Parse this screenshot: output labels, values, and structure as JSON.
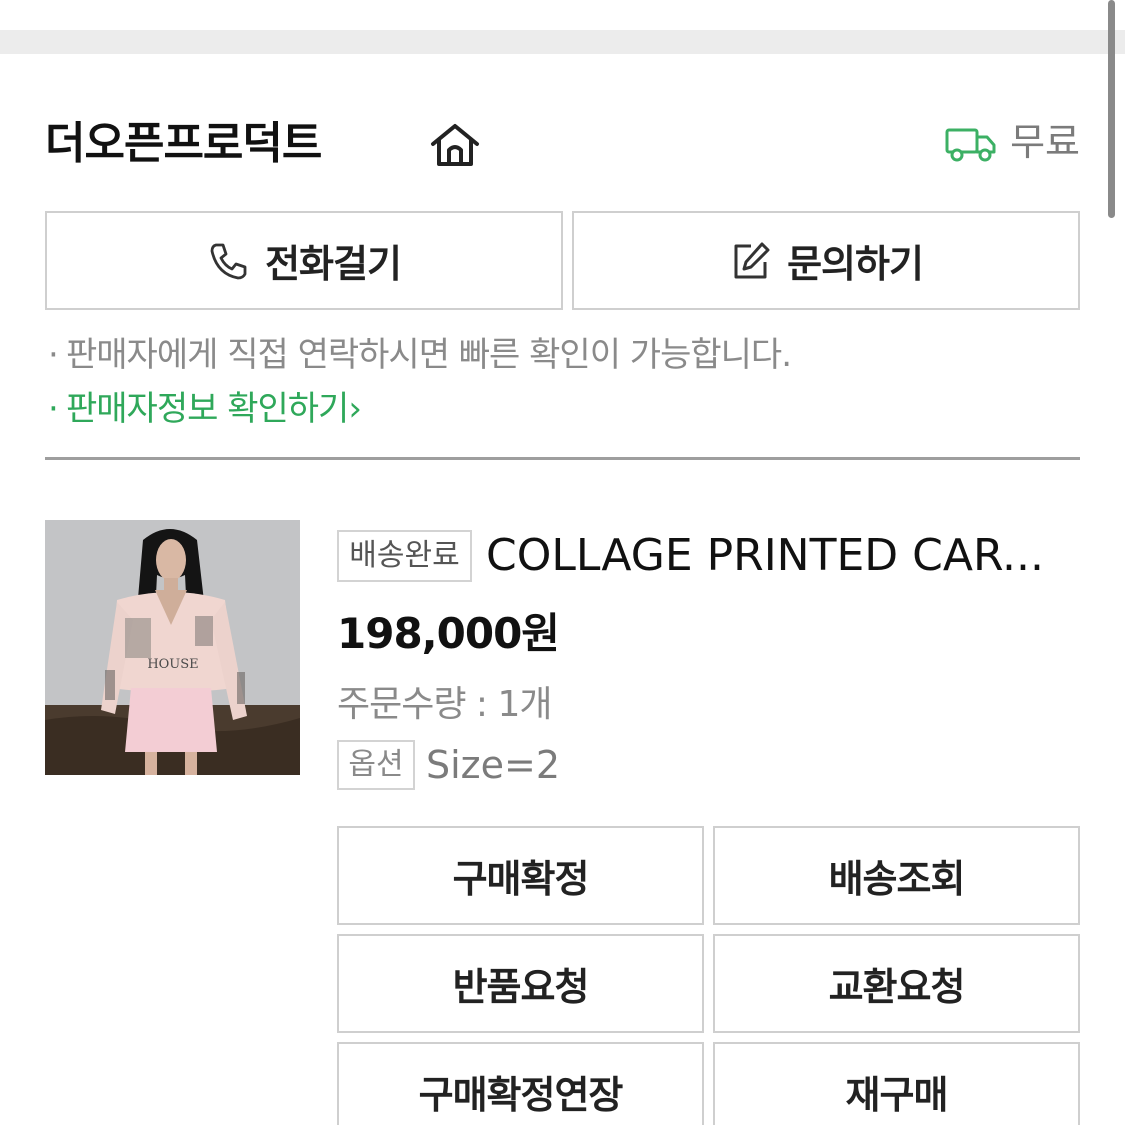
{
  "seller": {
    "name": "더오픈프로덕트",
    "delivery_label": "무료",
    "home_icon": "home-icon",
    "delivery_icon": "truck-icon"
  },
  "contact_buttons": {
    "call_label": "전화걸기",
    "call_icon": "phone-icon",
    "ask_label": "문의하기",
    "ask_icon": "edit-icon"
  },
  "notes": {
    "line1": "판매자에게 직접 연락하시면 빠른 확인이 가능합니다.",
    "line2": "판매자정보 확인하기",
    "line2_arrow": "›"
  },
  "product": {
    "status_badge": "배송완료",
    "title": "COLLAGE PRINTED CAR...",
    "price": "198,000원",
    "quantity": "주문수량 : 1개",
    "option_badge": "옵션",
    "option_value": "Size=2"
  },
  "actions": {
    "confirm": "구매확정",
    "track": "배송조회",
    "return": "반품요청",
    "exchange": "교환요청",
    "extend": "구매확정연장",
    "rebuy": "재구매"
  },
  "colors": {
    "accent_green": "#2fa85a",
    "border": "#cfcfcf",
    "muted_text": "#8a8a8a"
  }
}
